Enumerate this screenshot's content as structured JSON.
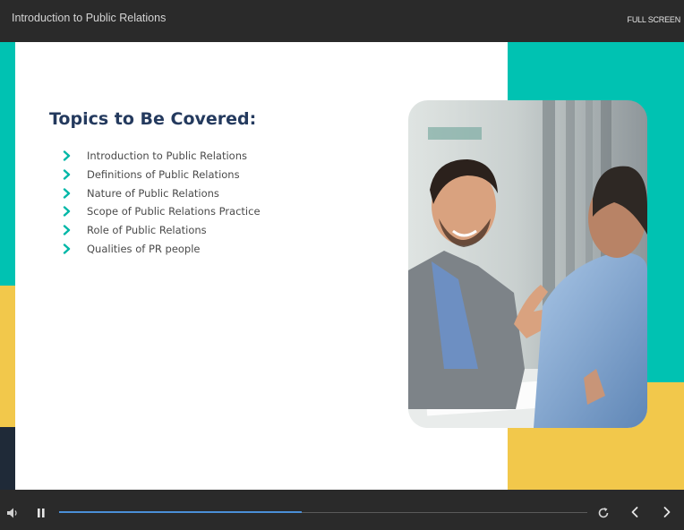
{
  "header": {
    "course_title": "Introduction to Public Relations",
    "fullscreen_label": "FULL SCREEN"
  },
  "slide": {
    "heading": "Topics to Be Covered:",
    "topics": [
      {
        "label": "Introduction to Public Relations"
      },
      {
        "label": "Definitions of Public Relations"
      },
      {
        "label": "Nature of Public Relations"
      },
      {
        "label": "Scope of Public Relations Practice"
      },
      {
        "label": "Role of Public Relations"
      },
      {
        "label": "Qualities of PR people"
      }
    ],
    "image": {
      "description_icon": "business-meeting-photo"
    }
  },
  "player": {
    "progress": 0.46,
    "icons": {
      "volume": "volume-icon",
      "pause": "pause-icon",
      "replay": "replay-icon",
      "previous": "chevron-left-icon",
      "next": "chevron-right-icon"
    }
  },
  "colors": {
    "teal": "#00c2b2",
    "yellow": "#f2c84b",
    "navy": "#1f2a38",
    "heading": "#243a5e",
    "progress": "#4a8fd8",
    "chrome": "#2a2a2a"
  }
}
